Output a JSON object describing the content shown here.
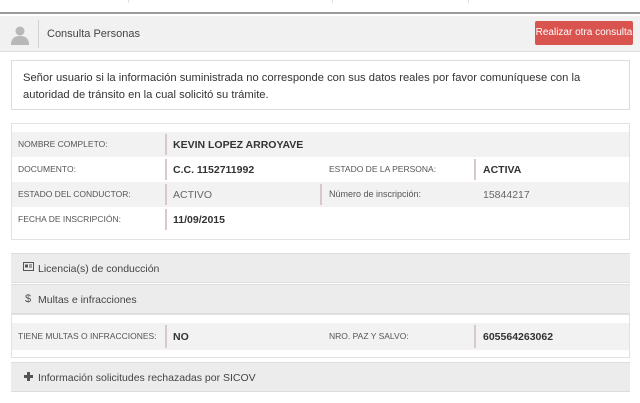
{
  "header": {
    "title": "Consulta Personas",
    "button_label": "Realizar otra consulta",
    "accent_color": "#d9534f"
  },
  "notice": {
    "text": "Señor usuario si la información suministrada no corresponde con sus datos reales por favor comuníquese con la autoridad de tránsito en la cual solicitó su trámite."
  },
  "persona": {
    "nombre_label": "NOMBRE COMPLETO:",
    "nombre_value": "KEVIN LOPEZ ARROYAVE",
    "documento_label": "DOCUMENTO:",
    "documento_value": "C.C. 1152711992",
    "estado_persona_label": "ESTADO DE LA PERSONA:",
    "estado_persona_value": "ACTIVA",
    "estado_conductor_label": "ESTADO DEL CONDUCTOR:",
    "estado_conductor_value": "ACTIVO",
    "numero_inscripcion_label": "Número de inscripción:",
    "numero_inscripcion_value": "15844217",
    "fecha_inscripcion_label": "FECHA DE INSCRIPCIÓN:",
    "fecha_inscripcion_value": "11/09/2015"
  },
  "sections": {
    "licencias": {
      "icon": "id-card-icon",
      "label": "Licencia(s) de conducción"
    },
    "multas": {
      "icon": "dollar-icon",
      "label": "Multas e infracciones"
    },
    "sicov": {
      "icon": "medkit-icon",
      "label": "Información solicitudes rechazadas por SICOV"
    }
  },
  "multas": {
    "tiene_label": "TIENE MULTAS O INFRACCIONES:",
    "tiene_value": "NO",
    "paz_label": "NRO. PAZ Y SALVO:",
    "paz_value": "605564263062"
  }
}
